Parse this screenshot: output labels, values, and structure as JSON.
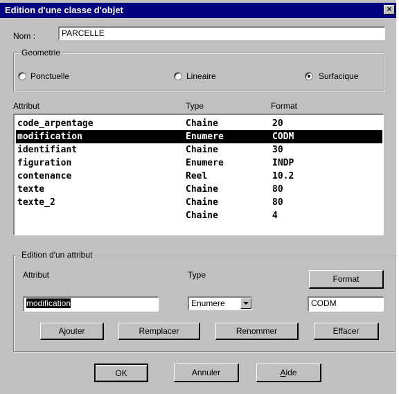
{
  "window": {
    "title": "Edition d'une classe d'objet",
    "close_glyph": "×"
  },
  "nom": {
    "label": "Nom :",
    "value": "PARCELLE"
  },
  "geometrie": {
    "legend": "Geometrie",
    "options": [
      "Ponctuelle",
      "Lineaire",
      "Surfacique"
    ],
    "selected": "Surfacique"
  },
  "attributes_table": {
    "headers": {
      "attribut": "Attribut",
      "type": "Type",
      "format": "Format"
    },
    "rows": [
      {
        "attribut": "code_arpentage",
        "type": "Chaine",
        "format": "20"
      },
      {
        "attribut": "modification",
        "type": "Enumere",
        "format": "CODM"
      },
      {
        "attribut": "identifiant",
        "type": "Chaine",
        "format": "30"
      },
      {
        "attribut": "figuration",
        "type": "Enumere",
        "format": "INDP"
      },
      {
        "attribut": "contenance",
        "type": "Reel",
        "format": "10.2"
      },
      {
        "attribut": "texte",
        "type": "Chaine",
        "format": "80"
      },
      {
        "attribut": "texte_2",
        "type": "Chaine",
        "format": "80"
      },
      {
        "attribut": "",
        "type": "Chaine",
        "format": "4"
      }
    ],
    "selected_index": 1
  },
  "edition": {
    "legend": "Edition d'un attribut",
    "attribut_label": "Attribut",
    "type_label": "Type",
    "format_button": "Format",
    "attribut_value": "modification",
    "type_value": "Enumere",
    "format_value": "CODM",
    "buttons": {
      "ajouter": "Ajouter",
      "remplacer": "Remplacer",
      "renommer": "Renommer",
      "effacer": "Effacer"
    }
  },
  "footer": {
    "ok": "OK",
    "annuler": "Annuler",
    "aide_first": "A",
    "aide_rest": "ide"
  },
  "colors": {
    "titlebar": "#000080",
    "face": "#c0c0c0",
    "selection": "#000000"
  },
  "icons": {
    "close": "close-icon",
    "dropdown": "chevron-down-icon"
  }
}
